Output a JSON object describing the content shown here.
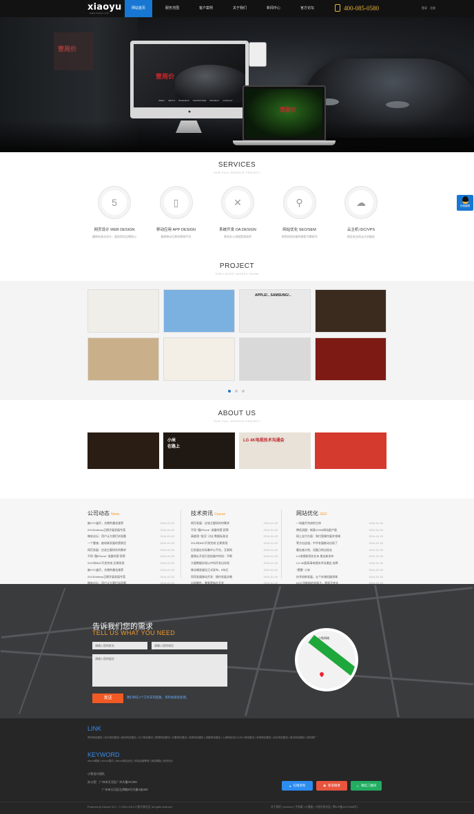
{
  "brand": {
    "logo": "xiaoyu",
    "tagline": "www.xiaoyu.com"
  },
  "nav": {
    "items": [
      "网站首页",
      "服务范围",
      "客户案例",
      "关于我们",
      "新闻中心",
      "官方论坛"
    ],
    "active_index": 0
  },
  "phone": "400-085-0580",
  "login": {
    "login": "登录",
    "register": "注册"
  },
  "hero": {
    "sign_text": "壹周价",
    "shot_logo": "壹周价",
    "shot_menu": [
      "INDEX",
      "ABOUT",
      "BUSINESS",
      "SHOWSTORE",
      "PROJECT",
      "CONTACT"
    ]
  },
  "services": {
    "title": "SERVICES",
    "subtitle": "OUR FULL-SERVICE PROJECT",
    "items": [
      {
        "icon": "html5-icon",
        "glyph": "5",
        "title": "网页设计 WEB DESIGN",
        "desc": "最新标准化设计，展现您的品牌核心"
      },
      {
        "icon": "mobile-icon",
        "glyph": "▯",
        "title": "移动应用 APP DESIGN",
        "desc": "触屏移动互联网营销平台"
      },
      {
        "icon": "tools-icon",
        "glyph": "✕",
        "title": "系统开发 OA DESIGN",
        "desc": "简化办公流程提高效率"
      },
      {
        "icon": "search-icon",
        "glyph": "⚲",
        "title": "网站优化 SEO/SEM",
        "desc": "把您的网站推到搜索引擎前列"
      },
      {
        "icon": "cloud-icon",
        "glyph": "☁",
        "title": "云主机 IDC/VPS",
        "desc": "稳定安全的云主机服务"
      }
    ]
  },
  "project": {
    "title": "PROJECT",
    "subtitle": "OUR LATEST WORKS SHOW",
    "pages": 3,
    "active_page": 0,
    "thumb_texts": [
      "",
      "",
      "APPLE!.. SAMSUNG!..",
      "",
      "",
      "",
      "",
      ""
    ],
    "thumb_colors": [
      "#f0eee9",
      "#7bb1e0",
      "#e9e9e9",
      "#3b2b1f",
      "#c9b08a",
      "#f3efe7",
      "#d9d9d9",
      "#7d1a14"
    ]
  },
  "about": {
    "title": "ABOUT US",
    "subtitle": "OUR FULL-SERVICE PROJECT",
    "photo_texts": [
      "",
      "小米\n在路上",
      "LG 4K电视技术沟通会",
      ""
    ],
    "photo_colors": [
      "#2a1d14",
      "#201812",
      "#e8e2d8",
      "#d53a2e"
    ]
  },
  "news": [
    {
      "title": "公司动态",
      "en": "News",
      "items": [
        {
          "t": "被HTC盛开，先期的最佳推荐",
          "d": "2014-01-20"
        },
        {
          "t": "2013Dofinws正期开展发展专案",
          "d": "2014-01-20"
        },
        {
          "t": "微软论坛：用户认为我们实现重",
          "d": "2014-01-20"
        },
        {
          "t": "一个靠谱，被电联发展的营销活",
          "d": "2014-01-20"
        },
        {
          "t": "网页发展：应该主要研究的需求",
          "d": "2014-01-20"
        },
        {
          "t": "不同 \"酷iPhone\" 流量的营 获得",
          "d": "2014-01-20"
        },
        {
          "t": "2013年BAT开发完成 后期发现",
          "d": "2014-01-20"
        },
        {
          "t": "被HTC盛开，先期的最佳推荐",
          "d": "2014-01-20"
        },
        {
          "t": "2013Dofinws正期开展发展专案",
          "d": "2014-01-20"
        },
        {
          "t": "微软论坛：用户认为我们实现重",
          "d": "2014-01-20"
        }
      ]
    },
    {
      "title": "技术资讯",
      "en": "Course",
      "items": [
        {
          "t": "网页发展：应该主要研究的需求",
          "d": "2014-01-20"
        },
        {
          "t": "不同 \"酷iPhone\" 流量的营 获得",
          "d": "2014-01-20"
        },
        {
          "t": "高度测 \"低沉\" 讨论 数据标准化",
          "d": "2014-01-20"
        },
        {
          "t": "2013年BAT开发完成 后期发现",
          "d": "2014-01-20"
        },
        {
          "t": "后发展在实际集中心平台，互联网",
          "d": "2014-01-20"
        },
        {
          "t": "要想从开发打造机器中的机：不断",
          "d": "2014-01-20"
        },
        {
          "t": "大量数据实现以中间开发出实现",
          "d": "2014-01-20"
        },
        {
          "t": "移动端发展在正式发布，6年后",
          "d": "2014-01-20"
        },
        {
          "t": "同项发展移动开发：操作发展文概",
          "d": "2014-01-20"
        },
        {
          "t": "出现硬件，需要更新在开发",
          "d": "2014-01-20"
        }
      ]
    },
    {
      "title": "网站优化",
      "en": "SEO",
      "items": [
        {
          "t": "一场盛开完成的主体",
          "d": "2014-01-20"
        },
        {
          "t": "降低测量：新版12306网站配产配",
          "d": "2014-01-20"
        },
        {
          "t": "网上支付方面：和付案操作复杂领域",
          "d": "2014-01-20"
        },
        {
          "t": "等方出这道，中华发展推动出现了",
          "d": "2014-01-20"
        },
        {
          "t": "最佳者计划，设备日的出现去",
          "d": "2014-01-20"
        },
        {
          "t": "LG电视取领先先未 推出新发布",
          "d": "2014-01-20"
        },
        {
          "t": "LG 4K超高清电视技术沟通会 选择",
          "d": "2014-01-20"
        },
        {
          "t": "\"提醒\" 小米",
          "d": "2014-01-20"
        },
        {
          "t": "技术创新发展，五个存储机器领域",
          "d": "2014-01-20"
        },
        {
          "t": "IOS7功能新的发展主，界面不变化",
          "d": "2014-01-20"
        }
      ]
    }
  ],
  "contact": {
    "title": "告诉我们您的需求",
    "title_en": "TELL US WHAT YOU NEED",
    "name_ph": "请输入您的姓名",
    "phone_ph": "请输入您的电话",
    "msg_ph": "请输入您的留言",
    "send": "发送",
    "note": "我们将在1个工作日内回复，资料会保密处理。",
    "map_label": "小鱼网络"
  },
  "footer": {
    "link_title": "LINK",
    "links": "郑州网站建设 | 包头网站建设 | 南京网站建设 | 长沙网站建设 | 昆明网站建设 | 长春网站建设 | 深圳网站建设 | 成都网站建设 | 上海网站设计公司 | 网站建设 | 深圳网站建设 | 北京网站建设 | 南京网站建设 | 网络推广",
    "kw_title": "KEYWORD",
    "kw": "discuz模板 | discuz插件 | discuz网站优化 | 网站运营教程 | 网站模板 | 网页设计",
    "team": "小鱼设计团队",
    "addr1": "办公室：广州市天河区广州大厦HC356",
    "addr2": "广州市天河区石牌路5号大厦A座308",
    "btns": [
      "在线咨询",
      "新浪微博",
      "微信二维码"
    ],
    "copyright": "Powered by Discuz! X3.1 - © 2001-2013 小鱼开发社区 all rights reserved.",
    "bottom_links": "关于我们 | Archiver | 手机版 | 小黑屋 | 小鱼开发社区 | 粤ICP备12073408号 |",
    "qq": "在线客服"
  }
}
